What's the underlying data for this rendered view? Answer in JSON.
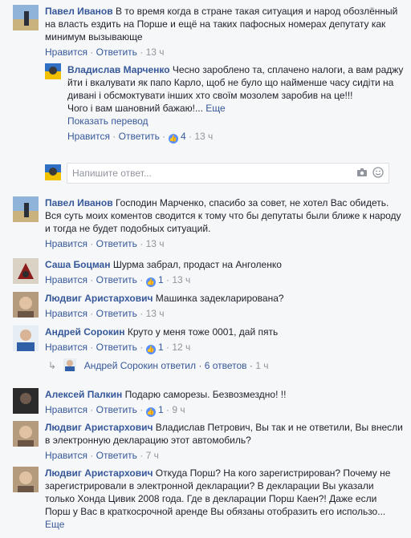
{
  "comments": [
    {
      "author": "Павел Иванов",
      "text": "В то время когда в стране такая ситуация и народ обозлённый на власть ездить на Порше и ещё на таких пафосных номерах депутату как минимум вызывающе",
      "like": "Нравится",
      "reply": "Ответить",
      "likes": "",
      "time": "13 ч"
    },
    {
      "author": "Владислав Марченко",
      "text": "Чесно зароблено та, сплачено налоги, а вам раджу йти і вкалувати як папо Карло, щоб не було що найменше часу сидіти на дивані і обсмоктувати інших хто своїм мозолем заробив на це!!!",
      "text2": "Чого і вам шановний бажаю!...",
      "more": "Еще",
      "translate": "Показать перевод",
      "like": "Нравится",
      "reply": "Ответить",
      "likes": "4",
      "time": "13 ч"
    },
    {
      "author": "Павел Иванов",
      "text": "Господин Марченко, спасибо за совет, не хотел Вас обидеть. Вся суть моих коментов сводится к тому что бы депутаты были ближе к народу и тогда не будет подобных ситуаций.",
      "like": "Нравится",
      "reply": "Ответить",
      "likes": "",
      "time": "13 ч"
    },
    {
      "author": "Саша Боцман",
      "text": "Шурма забрал, продаст на Анголенко",
      "like": "Нравится",
      "reply": "Ответить",
      "likes": "1",
      "time": "13 ч"
    },
    {
      "author": "Людвиг Аристархович",
      "text": "Машинка задекларирована?",
      "like": "Нравится",
      "reply": "Ответить",
      "likes": "",
      "time": "13 ч"
    },
    {
      "author": "Андрей Сорокин",
      "text": "Круто у меня тоже 0001, дай пять",
      "like": "Нравится",
      "reply": "Ответить",
      "likes": "1",
      "time": "12 ч"
    },
    {
      "author": "Алексей Палкин",
      "text": "Подарю саморезы. Безвозмездно! !!",
      "like": "Нравится",
      "reply": "Ответить",
      "likes": "1",
      "time": "9 ч"
    },
    {
      "author": "Людвиг Аристархович",
      "text": "Владислав Петрович, Вы так и не ответили, Вы внесли в электронную декларацию этот автомобиль?",
      "like": "Нравится",
      "reply": "Ответить",
      "likes": "",
      "time": "7 ч"
    },
    {
      "author": "Людвиг Аристархович",
      "text": "Откуда Порш? На кого зарегистрирован? Почему не зарегистрировали в электронной декларации? В декларации Вы указали только Хонда Цивик 2008 года. Где в декларации Порш Каен?! Даже если Порш у Вас в краткосрочной аренде Вы обязаны отобразить его использо...",
      "more": "Еще"
    }
  ],
  "reply_input": {
    "placeholder": "Напишите ответ..."
  },
  "thread": {
    "author": "Андрей Сорокин",
    "action": "ответил",
    "count": "6 ответов",
    "time": "1 ч"
  },
  "sep": "·",
  "colors": {
    "link": "#365899",
    "text": "#1d2129",
    "muted": "#90949c",
    "like": "#5890ff"
  }
}
